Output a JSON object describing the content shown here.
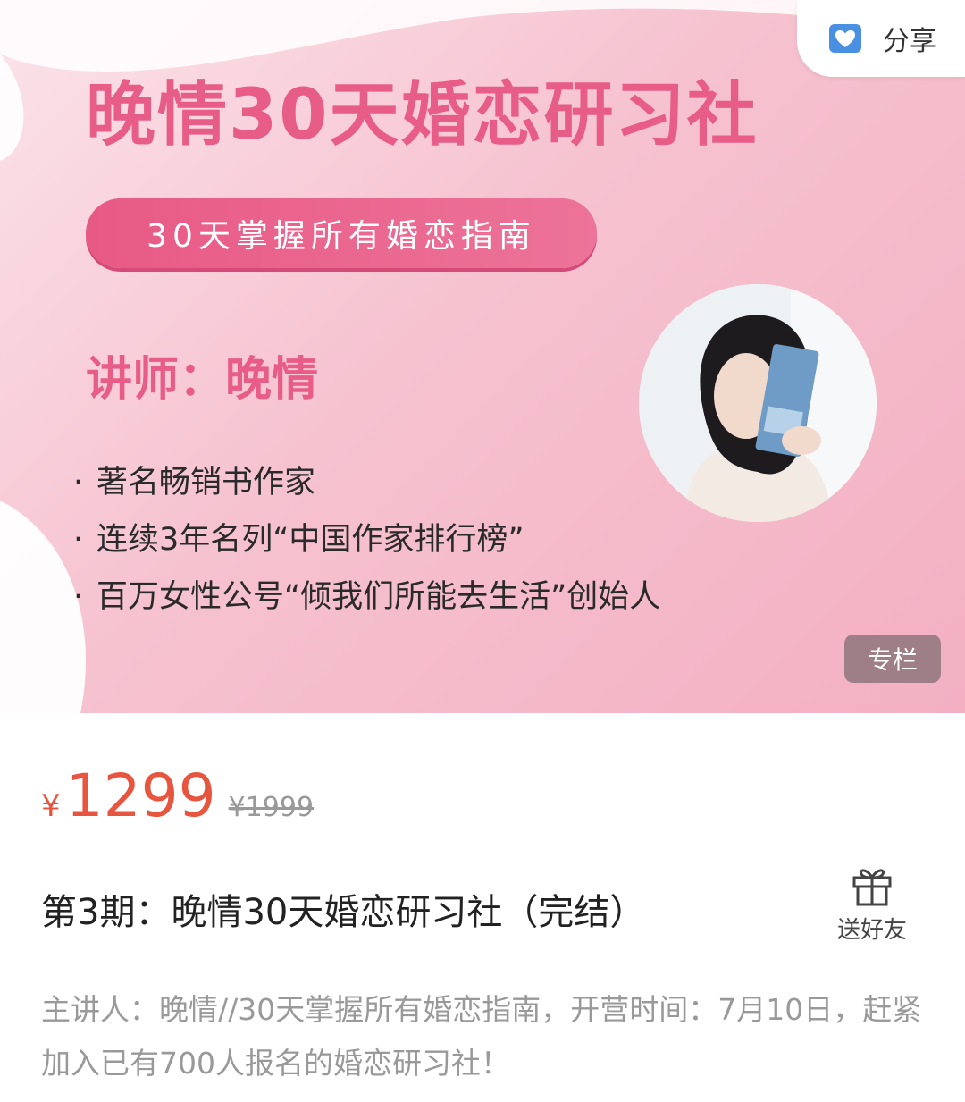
{
  "banner": {
    "title": "晚情30天婚恋研习社",
    "subtitle": "30天掌握所有婚恋指南",
    "lecturer": "讲师：晚情",
    "bullets": [
      "著名畅销书作家",
      "连续3年名列“中国作家排行榜”",
      "百万女性公号“倾我们所能去生活”创始人"
    ],
    "badge": "专栏",
    "share_label": "分享",
    "accent_color": "#e85d87"
  },
  "pricing": {
    "currency": "¥",
    "price": "1299",
    "original_price": "¥1999",
    "price_color": "#e8553e"
  },
  "course": {
    "title": "第3期：晚情30天婚恋研习社（完结）",
    "gift_label": "送好友",
    "description": "主讲人：晚情//30天掌握所有婚恋指南，开营时间：7月10日，赶紧加入已有700人报名的婚恋研习社！"
  },
  "icons": {
    "share": "share-heart-icon",
    "gift": "gift-icon"
  }
}
